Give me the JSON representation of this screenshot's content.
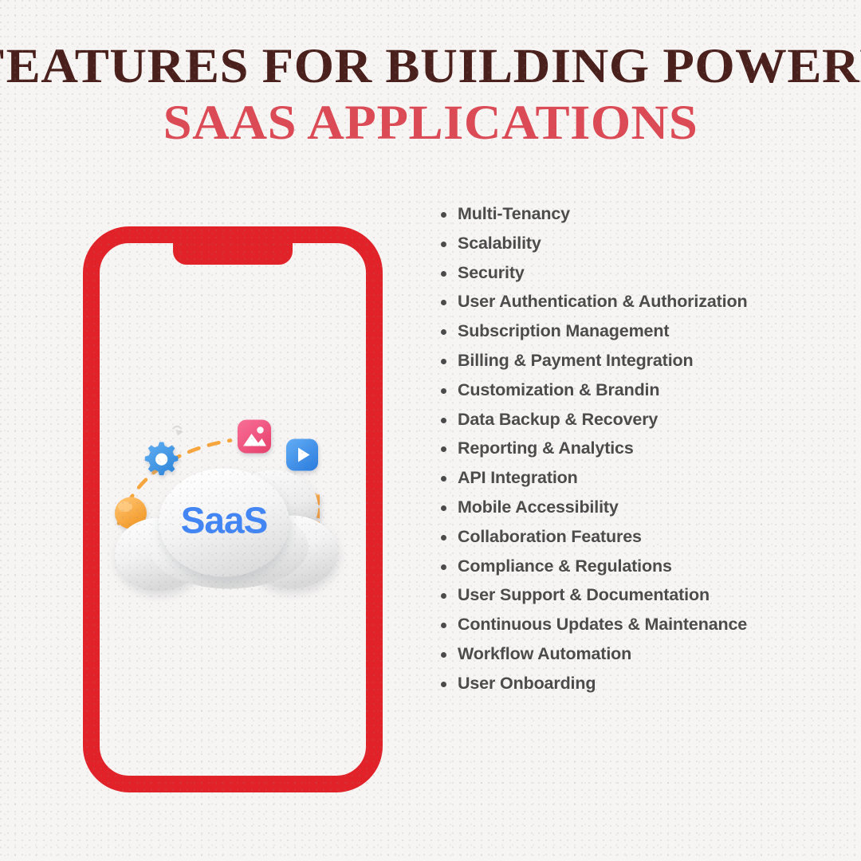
{
  "page": {
    "background_color": "#f7f5f4",
    "texture": "dotted-paper"
  },
  "title": {
    "line1": "FEATURES FOR BUILDING POWERFUL",
    "line2": "SAAS APPLICATIONS",
    "line1_color": "#4a201d",
    "line2_color": "#dc4a55"
  },
  "phone": {
    "frame_color": "#e12229",
    "screen_color": "#ffffff",
    "notch": "phone-notch"
  },
  "illustration": {
    "name": "saas-cloud-illustration",
    "cloud_label": "SaaS",
    "cloud_label_color": "#4285f4",
    "cloud_color": "#efefef",
    "icons": [
      {
        "name": "gear-icon",
        "color": "#3d9ae8"
      },
      {
        "name": "image-icon",
        "color": "#f0537f"
      },
      {
        "name": "video-play-icon",
        "color": "#3f95ef"
      },
      {
        "name": "database-stack-icon",
        "color": "#f7a33e"
      },
      {
        "name": "orange-sphere",
        "color": "#f5a83c"
      },
      {
        "name": "dashed-arc",
        "color": "#f6a63c"
      },
      {
        "name": "small-arrow-icon",
        "color": "#d8d8d8"
      }
    ]
  },
  "features": {
    "text_color": "#4b4b4b",
    "bullet_color": "#4b4b4b",
    "items": [
      "Multi-Tenancy",
      "Scalability",
      "Security",
      "User Authentication & Authorization",
      "Subscription Management",
      "Billing & Payment Integration",
      "Customization & Brandin",
      "Data Backup & Recovery",
      "Reporting & Analytics",
      "API Integration",
      "Mobile Accessibility",
      "Collaboration Features",
      "Compliance & Regulations",
      "User Support & Documentation",
      "Continuous Updates & Maintenance",
      "Workflow Automation",
      "User Onboarding"
    ]
  }
}
